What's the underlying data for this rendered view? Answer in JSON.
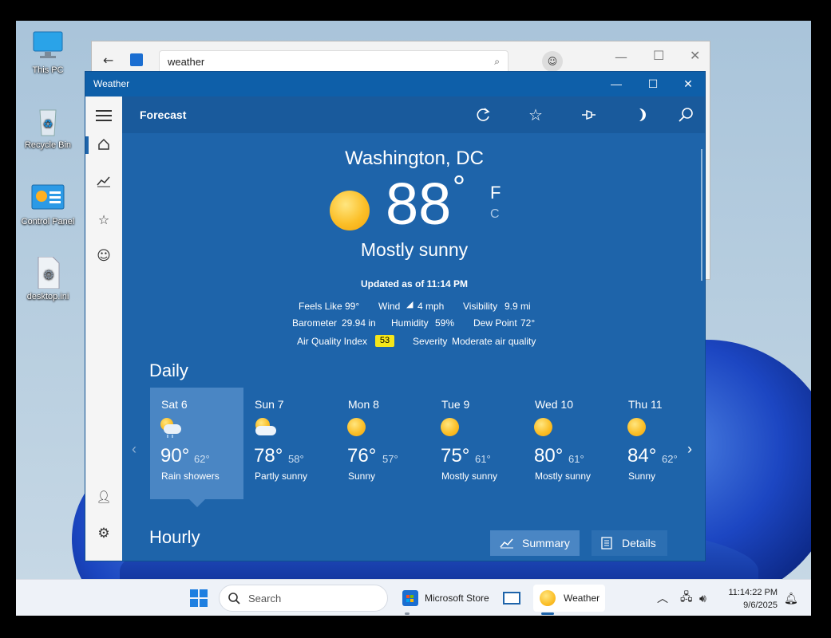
{
  "desktop": {
    "icons": [
      {
        "label": "This PC",
        "icon": "monitor-icon"
      },
      {
        "label": "Recycle Bin",
        "icon": "recycle-bin-icon"
      },
      {
        "label": "Control Panel",
        "icon": "control-panel-icon"
      },
      {
        "label": "desktop.ini",
        "icon": "settings-file-icon"
      }
    ]
  },
  "store_window": {
    "search_value": "weather"
  },
  "weather_window": {
    "title": "Weather",
    "header_title": "Forecast",
    "location": "Washington, DC",
    "temperature": "88",
    "degree": "°",
    "unit_f": "F",
    "unit_c": "C",
    "condition": "Mostly sunny",
    "updated": "Updated as of 11:14 PM",
    "details": {
      "feels_like_label": "Feels Like",
      "feels_like_value": "99°",
      "wind_label": "Wind",
      "wind_value": "4 mph",
      "visibility_label": "Visibility",
      "visibility_value": "9.9 mi",
      "barometer_label": "Barometer",
      "barometer_value": "29.94 in",
      "humidity_label": "Humidity",
      "humidity_value": "59%",
      "dew_point_label": "Dew Point",
      "dew_point_value": "72°",
      "aqi_label": "Air Quality Index",
      "aqi_value": "53",
      "severity_label": "Severity",
      "severity_value": "Moderate air quality"
    },
    "daily_title": "Daily",
    "days": [
      {
        "name": "Sat 6",
        "hi": "90°",
        "lo": "62°",
        "cond": "Rain showers",
        "icon": "rain-showers-icon"
      },
      {
        "name": "Sun 7",
        "hi": "78°",
        "lo": "58°",
        "cond": "Partly sunny",
        "icon": "partly-sunny-icon"
      },
      {
        "name": "Mon 8",
        "hi": "76°",
        "lo": "57°",
        "cond": "Sunny",
        "icon": "sun-icon"
      },
      {
        "name": "Tue 9",
        "hi": "75°",
        "lo": "61°",
        "cond": "Mostly sunny",
        "icon": "sun-icon"
      },
      {
        "name": "Wed 10",
        "hi": "80°",
        "lo": "61°",
        "cond": "Mostly sunny",
        "icon": "sun-icon"
      },
      {
        "name": "Thu 11",
        "hi": "84°",
        "lo": "62°",
        "cond": "Sunny",
        "icon": "sun-icon"
      }
    ],
    "hourly_title": "Hourly",
    "summary_label": "Summary",
    "details_label": "Details"
  },
  "taskbar": {
    "search_placeholder": "Search",
    "apps": [
      {
        "label": "Microsoft Store"
      },
      {
        "label": "Weather"
      }
    ],
    "time": "11:14:22 PM",
    "date": "9/6/2025"
  },
  "colors": {
    "accent": "#1e64aa",
    "aqi_badge": "#f5e61a"
  }
}
